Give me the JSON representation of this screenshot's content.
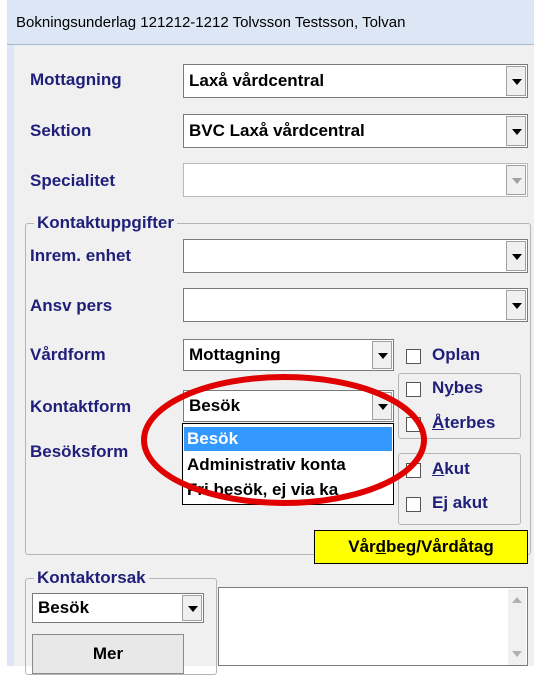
{
  "window": {
    "title": "Bokningsunderlag  121212-1212 Tolvsson Testsson, Tolvan"
  },
  "fields": {
    "mottagning": {
      "label": "Mottagning",
      "value": "Laxå vårdcentral"
    },
    "sektion": {
      "label": "Sektion",
      "value": "BVC Laxå vårdcentral"
    },
    "specialitet": {
      "label": "Specialitet",
      "value": ""
    }
  },
  "kontakt": {
    "group_title": "Kontaktuppgifter",
    "inrem_label": "Inrem. enhet",
    "inrem_value": "",
    "ansv_label": "Ansv pers",
    "ansv_value": "",
    "vardform_label": "Vårdform",
    "vardform_value": "Mottagning",
    "kontaktform_label": "Kontaktform",
    "kontaktform_value": "Besök",
    "besoksform_label": "Besöksform"
  },
  "dropdown": {
    "options": [
      "Besök",
      "Administrativ konta",
      "Fri besök, ej via ka"
    ],
    "selected_index": 0
  },
  "checkboxes": {
    "oplan": "Oplan",
    "nybes_pre": "N",
    "nybes_u": "y",
    "nybes_post": "bes",
    "aterbes_u": "Å",
    "aterbes_post": "terbes",
    "akut_u": "A",
    "akut_post": "kut",
    "ejakut_pre": "E",
    "ejakut_u": "j",
    "ejakut_post": " akut"
  },
  "vardbeg_button": {
    "pre": "Vår",
    "u": "d",
    "post": "beg/Vårdåtag"
  },
  "kontaktorsak": {
    "group_title": "Kontaktorsak",
    "value": "Besök",
    "mer_label": "Mer"
  },
  "colors": {
    "selection": "#3399ff",
    "highlight_button": "#ffff00",
    "annotation_ring": "#e00000"
  }
}
